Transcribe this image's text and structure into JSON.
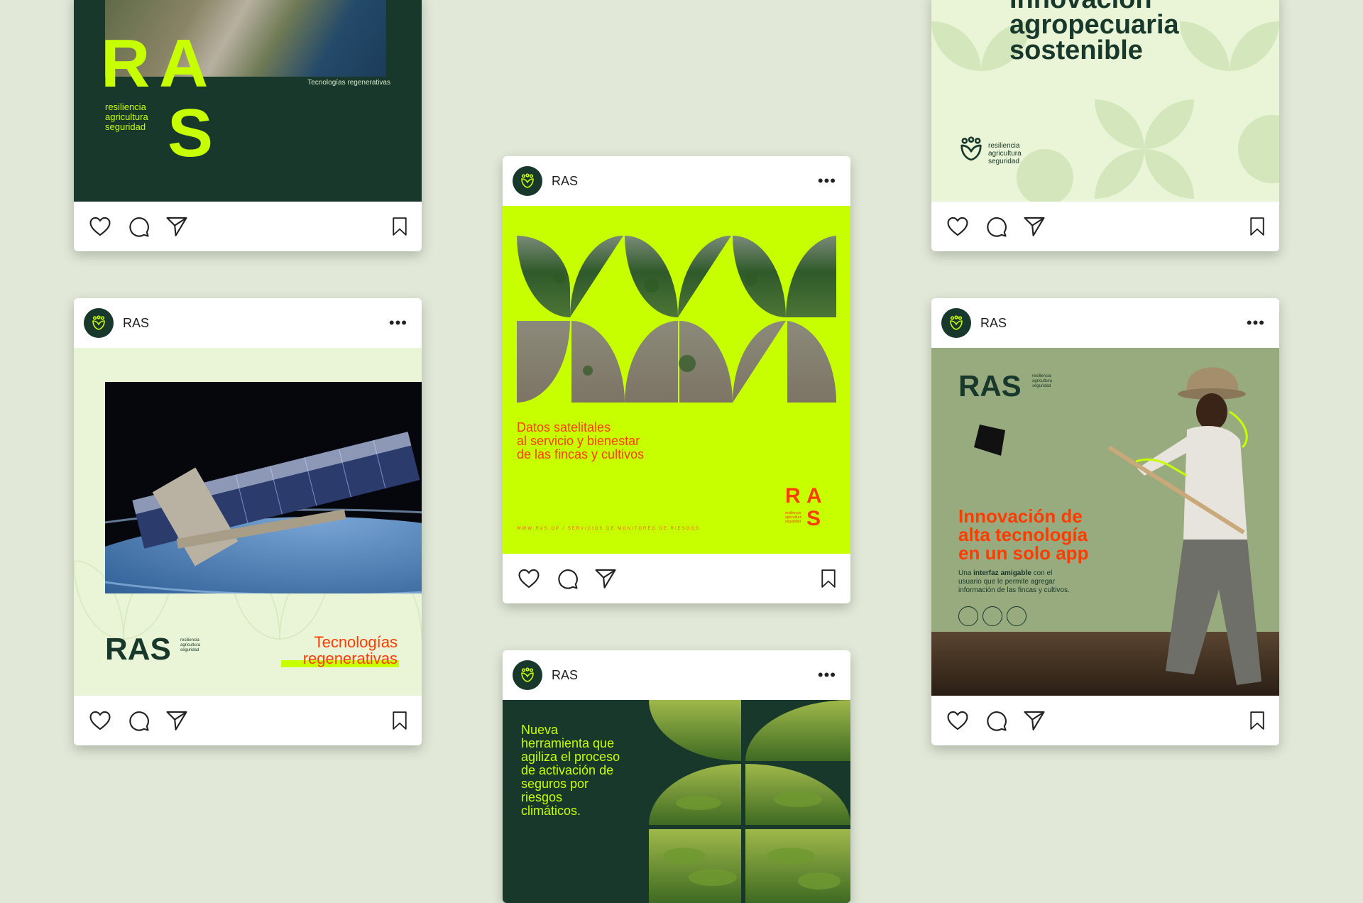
{
  "account": {
    "name": "RAS"
  },
  "posts": [
    {
      "id": "post-1",
      "logo_letters": [
        "R",
        "A",
        "S"
      ],
      "tagline": [
        "resiliencia",
        "agricultura",
        "seguridad"
      ],
      "caption": "Tecnologías regenerativas"
    },
    {
      "id": "post-2",
      "headline": [
        "Innovación",
        "agropecuaria",
        "sostenible"
      ],
      "logo_tagline": [
        "resiliencia",
        "agricultura",
        "seguridad"
      ]
    },
    {
      "id": "post-3",
      "headline": [
        "Datos satelitales",
        "al servicio y bienestar",
        "de las fincas y cultivos"
      ],
      "footer": "WWW.RAS.OP / SERVICIOS DE MONITOREO DE RIESGOS",
      "logo_letters": [
        "R",
        "A",
        "S"
      ],
      "logo_tagline": [
        "resiliencia",
        "agricultura",
        "seguridad"
      ]
    },
    {
      "id": "post-4",
      "logo": "RAS",
      "logo_tagline": [
        "resiliencia",
        "agricultura",
        "seguridad"
      ],
      "title": [
        "Tecnologías",
        "regenerativas"
      ]
    },
    {
      "id": "post-5",
      "logo": "RAS",
      "logo_tagline": [
        "resiliencia",
        "agricultura",
        "seguridad"
      ],
      "headline": [
        "Innovación de",
        "alta tecnología",
        "en un solo app"
      ],
      "body_prefix": "Una ",
      "body_bold": "interfaz amigable",
      "body_rest": " con el",
      "body_lines": [
        "usuario que le permite agregar",
        "información de las fincas y cultivos."
      ]
    },
    {
      "id": "post-6",
      "headline": [
        "Nueva",
        "herramienta que",
        "agiliza el proceso",
        "de activación de",
        "seguros por",
        "riesgos",
        "climáticos."
      ]
    }
  ],
  "icons": {
    "like": "heart-icon",
    "comment": "comment-icon",
    "share": "send-icon",
    "save": "bookmark-icon",
    "more": "more-icon",
    "logo": "ras-logo-icon"
  },
  "colors": {
    "background": "#e2e8d8",
    "dark_green": "#17382a",
    "lime": "#c8ff00",
    "pale_green": "#e9f5d6",
    "sage": "#98ab7e",
    "red_orange": "#ff3c00"
  }
}
